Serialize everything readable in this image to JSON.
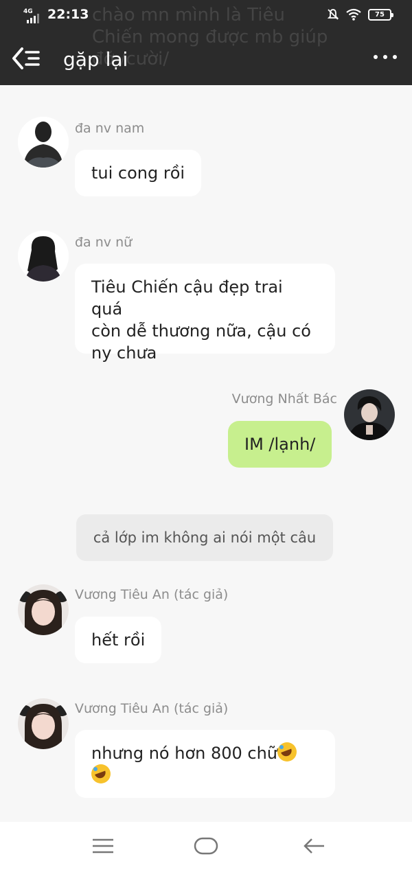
{
  "status_bar": {
    "network": "4G",
    "time": "22:13",
    "battery": "75"
  },
  "header": {
    "title": "gặp lại",
    "ghost_preview": "chào mn mình là Tiêu Chiến mong được mb giúp đỡ /cười/"
  },
  "messages": [
    {
      "sender": "đa nv nam",
      "text": "tui cong rồi"
    },
    {
      "sender": "đa nv nữ",
      "lines": [
        "Tiêu Chiến cậu đẹp trai quá",
        "còn dễ thương nữa, cậu có",
        "ny chưa"
      ]
    },
    {
      "sender": "Vương Nhất Bác",
      "text": "IM /lạnh/"
    },
    {
      "system": "cả lớp im không ai nói một câu"
    },
    {
      "sender": "Vương Tiêu An (tác giả)",
      "text": "hết rồi"
    },
    {
      "sender": "Vương Tiêu An (tác giả)",
      "text": "nhưng nó hơn 800 chữ"
    }
  ],
  "icons": {
    "back": "back-list-icon",
    "more": "more-dots-icon",
    "nav": [
      "menu-icon",
      "home-icon",
      "back-arrow-icon"
    ]
  },
  "colors": {
    "header_bg": "#2b2b2b",
    "my_bubble": "#c7ef8e",
    "bubble": "#ffffff",
    "background": "#f7f7f7"
  }
}
